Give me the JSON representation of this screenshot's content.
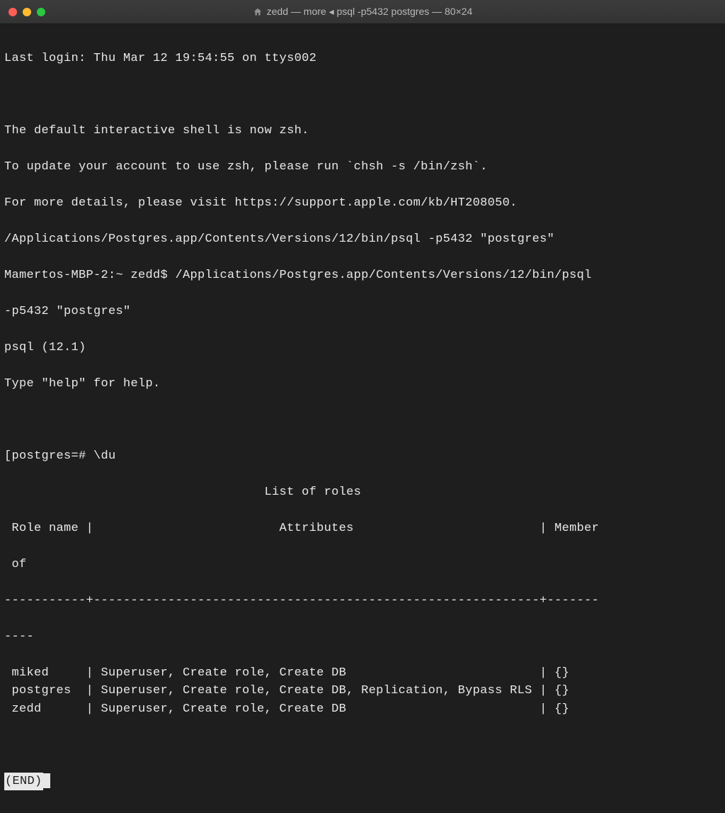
{
  "window": {
    "title": "zedd — more ◂ psql -p5432 postgres — 80×24"
  },
  "lines": {
    "last_login": "Last login: Thu Mar 12 19:54:55 on ttys002",
    "blank1": "",
    "zsh_notice": "The default interactive shell is now zsh.",
    "zsh_update": "To update your account to use zsh, please run `chsh -s /bin/zsh`.",
    "zsh_details": "For more details, please visit https://support.apple.com/kb/HT208050.",
    "psql_path": "/Applications/Postgres.app/Contents/Versions/12/bin/psql -p5432 \"postgres\"",
    "prompt_line": "Mamertos-MBP-2:~ zedd$ /Applications/Postgres.app/Contents/Versions/12/bin/psql ",
    "prompt_line2": "-p5432 \"postgres\"",
    "psql_version": "psql (12.1)",
    "help_hint": "Type \"help\" for help.",
    "blank2": "",
    "psql_prompt": "[postgres=# \\du",
    "list_title": "                                   List of roles",
    "header": " Role name |                         Attributes                         | Member",
    "header2": " of",
    "separator": "-----------+------------------------------------------------------------+-------",
    "separator2": "----"
  },
  "roles": [
    {
      "name": "miked",
      "attrs": "Superuser, Create role, Create DB",
      "member": "{}"
    },
    {
      "name": "postgres",
      "attrs": "Superuser, Create role, Create DB, Replication, Bypass RLS",
      "member": "{}"
    },
    {
      "name": "zedd",
      "attrs": "Superuser, Create role, Create DB",
      "member": "{}"
    }
  ],
  "pager": {
    "end": "(END)"
  }
}
